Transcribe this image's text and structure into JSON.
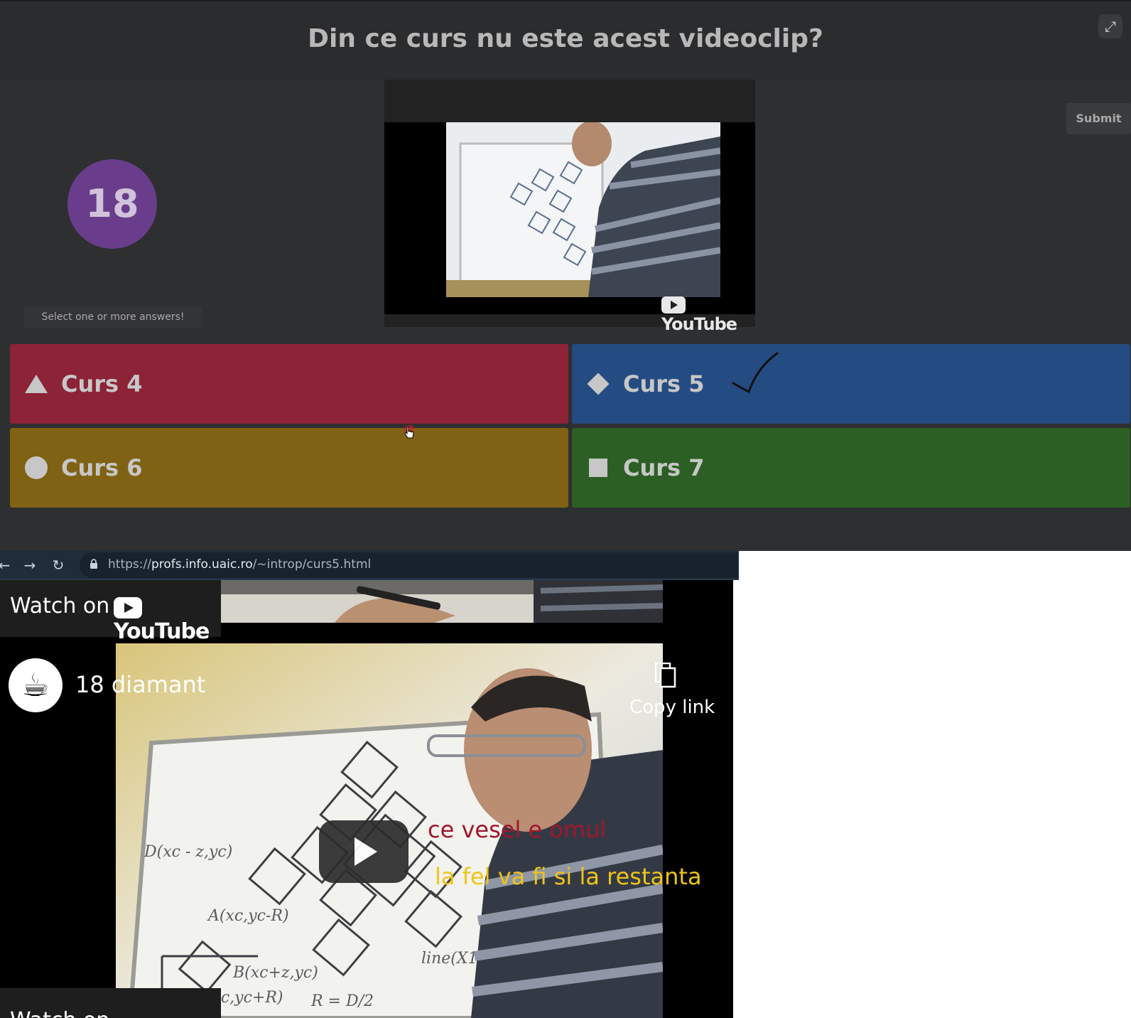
{
  "quiz": {
    "question": "Din ce curs nu este acest videoclip?",
    "timer": "18",
    "hint": "Select one or more answers!",
    "submit_label": "Submit",
    "fullscreen_icon": "expand-icon",
    "answers": [
      {
        "label": "Curs 4",
        "shape": "triangle",
        "color": "#8c2336"
      },
      {
        "label": "Curs 5",
        "shape": "diamond",
        "color": "#254c82"
      },
      {
        "label": "Curs 6",
        "shape": "circle",
        "color": "#806214"
      },
      {
        "label": "Curs 7",
        "shape": "square",
        "color": "#2c5f23"
      }
    ],
    "small_video": {
      "brand": "YouTube"
    }
  },
  "browser": {
    "url_prefix": "https://",
    "url_domain": "profs.info.uaic.ro",
    "url_path": "/~introp/curs5.html"
  },
  "video": {
    "watch_on": "Watch on",
    "brand": "YouTube",
    "title": "18 diamant",
    "copy_link": "Copy link",
    "annotation_1": "ce vesel e omul",
    "annotation_2": "la fel va fi si la restanta",
    "annotation_1_color": "#a0162c",
    "annotation_2_color": "#f0c318"
  }
}
